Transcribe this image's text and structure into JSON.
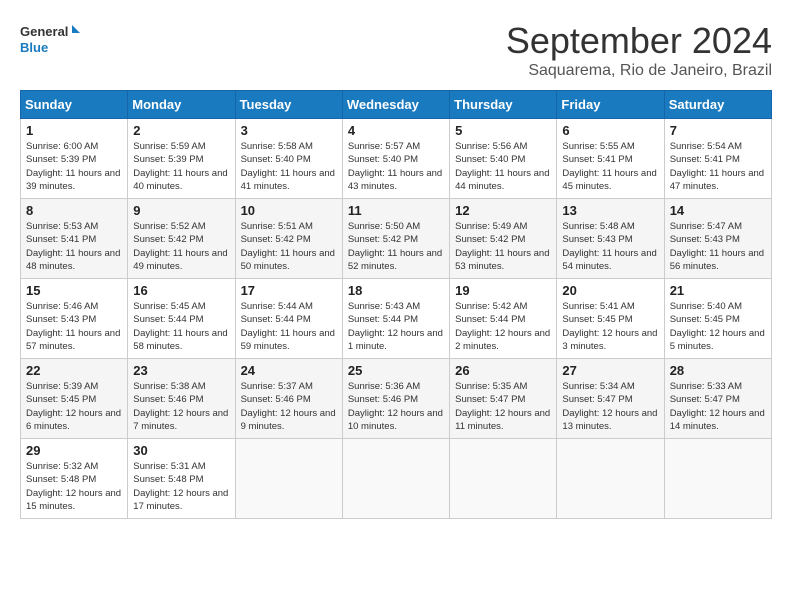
{
  "header": {
    "logo_line1": "General",
    "logo_line2": "Blue",
    "month": "September 2024",
    "location": "Saquarema, Rio de Janeiro, Brazil"
  },
  "weekdays": [
    "Sunday",
    "Monday",
    "Tuesday",
    "Wednesday",
    "Thursday",
    "Friday",
    "Saturday"
  ],
  "weeks": [
    [
      {
        "day": "1",
        "sunrise": "6:00 AM",
        "sunset": "5:39 PM",
        "daylight": "11 hours and 39 minutes."
      },
      {
        "day": "2",
        "sunrise": "5:59 AM",
        "sunset": "5:39 PM",
        "daylight": "11 hours and 40 minutes."
      },
      {
        "day": "3",
        "sunrise": "5:58 AM",
        "sunset": "5:40 PM",
        "daylight": "11 hours and 41 minutes."
      },
      {
        "day": "4",
        "sunrise": "5:57 AM",
        "sunset": "5:40 PM",
        "daylight": "11 hours and 43 minutes."
      },
      {
        "day": "5",
        "sunrise": "5:56 AM",
        "sunset": "5:40 PM",
        "daylight": "11 hours and 44 minutes."
      },
      {
        "day": "6",
        "sunrise": "5:55 AM",
        "sunset": "5:41 PM",
        "daylight": "11 hours and 45 minutes."
      },
      {
        "day": "7",
        "sunrise": "5:54 AM",
        "sunset": "5:41 PM",
        "daylight": "11 hours and 47 minutes."
      }
    ],
    [
      {
        "day": "8",
        "sunrise": "5:53 AM",
        "sunset": "5:41 PM",
        "daylight": "11 hours and 48 minutes."
      },
      {
        "day": "9",
        "sunrise": "5:52 AM",
        "sunset": "5:42 PM",
        "daylight": "11 hours and 49 minutes."
      },
      {
        "day": "10",
        "sunrise": "5:51 AM",
        "sunset": "5:42 PM",
        "daylight": "11 hours and 50 minutes."
      },
      {
        "day": "11",
        "sunrise": "5:50 AM",
        "sunset": "5:42 PM",
        "daylight": "11 hours and 52 minutes."
      },
      {
        "day": "12",
        "sunrise": "5:49 AM",
        "sunset": "5:42 PM",
        "daylight": "11 hours and 53 minutes."
      },
      {
        "day": "13",
        "sunrise": "5:48 AM",
        "sunset": "5:43 PM",
        "daylight": "11 hours and 54 minutes."
      },
      {
        "day": "14",
        "sunrise": "5:47 AM",
        "sunset": "5:43 PM",
        "daylight": "11 hours and 56 minutes."
      }
    ],
    [
      {
        "day": "15",
        "sunrise": "5:46 AM",
        "sunset": "5:43 PM",
        "daylight": "11 hours and 57 minutes."
      },
      {
        "day": "16",
        "sunrise": "5:45 AM",
        "sunset": "5:44 PM",
        "daylight": "11 hours and 58 minutes."
      },
      {
        "day": "17",
        "sunrise": "5:44 AM",
        "sunset": "5:44 PM",
        "daylight": "11 hours and 59 minutes."
      },
      {
        "day": "18",
        "sunrise": "5:43 AM",
        "sunset": "5:44 PM",
        "daylight": "12 hours and 1 minute."
      },
      {
        "day": "19",
        "sunrise": "5:42 AM",
        "sunset": "5:44 PM",
        "daylight": "12 hours and 2 minutes."
      },
      {
        "day": "20",
        "sunrise": "5:41 AM",
        "sunset": "5:45 PM",
        "daylight": "12 hours and 3 minutes."
      },
      {
        "day": "21",
        "sunrise": "5:40 AM",
        "sunset": "5:45 PM",
        "daylight": "12 hours and 5 minutes."
      }
    ],
    [
      {
        "day": "22",
        "sunrise": "5:39 AM",
        "sunset": "5:45 PM",
        "daylight": "12 hours and 6 minutes."
      },
      {
        "day": "23",
        "sunrise": "5:38 AM",
        "sunset": "5:46 PM",
        "daylight": "12 hours and 7 minutes."
      },
      {
        "day": "24",
        "sunrise": "5:37 AM",
        "sunset": "5:46 PM",
        "daylight": "12 hours and 9 minutes."
      },
      {
        "day": "25",
        "sunrise": "5:36 AM",
        "sunset": "5:46 PM",
        "daylight": "12 hours and 10 minutes."
      },
      {
        "day": "26",
        "sunrise": "5:35 AM",
        "sunset": "5:47 PM",
        "daylight": "12 hours and 11 minutes."
      },
      {
        "day": "27",
        "sunrise": "5:34 AM",
        "sunset": "5:47 PM",
        "daylight": "12 hours and 13 minutes."
      },
      {
        "day": "28",
        "sunrise": "5:33 AM",
        "sunset": "5:47 PM",
        "daylight": "12 hours and 14 minutes."
      }
    ],
    [
      {
        "day": "29",
        "sunrise": "5:32 AM",
        "sunset": "5:48 PM",
        "daylight": "12 hours and 15 minutes."
      },
      {
        "day": "30",
        "sunrise": "5:31 AM",
        "sunset": "5:48 PM",
        "daylight": "12 hours and 17 minutes."
      },
      null,
      null,
      null,
      null,
      null
    ]
  ]
}
